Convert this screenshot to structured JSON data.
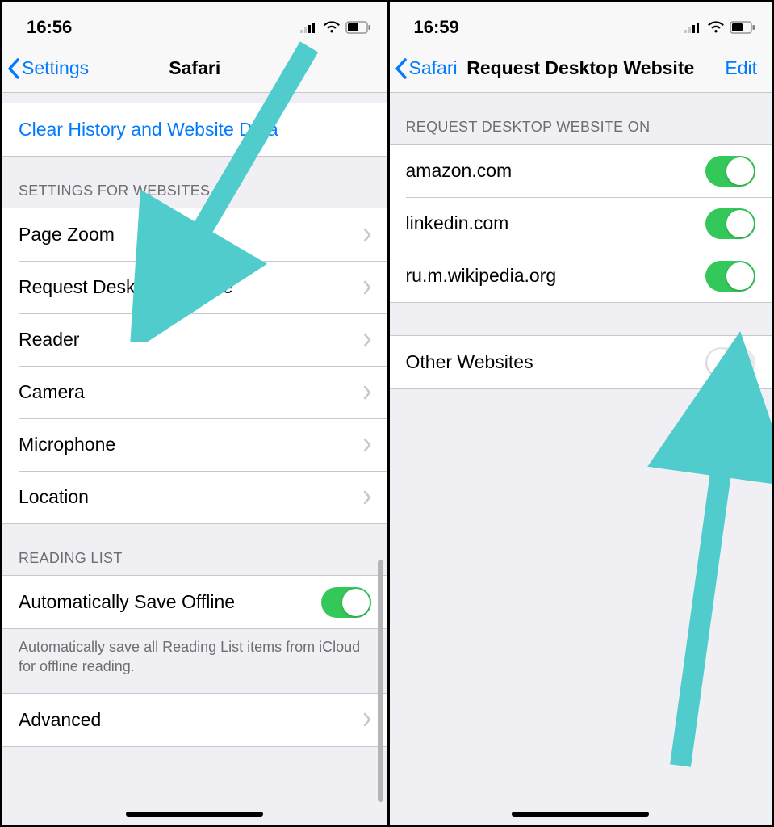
{
  "left": {
    "status_time": "16:56",
    "nav_back": "Settings",
    "nav_title": "Safari",
    "clear_label": "Clear History and Website Data",
    "section_websites": "SETTINGS FOR WEBSITES",
    "rows": {
      "page_zoom": "Page Zoom",
      "request_desktop": "Request Desktop Website",
      "reader": "Reader",
      "camera": "Camera",
      "microphone": "Microphone",
      "location": "Location"
    },
    "section_reading": "READING LIST",
    "auto_save": "Automatically Save Offline",
    "auto_save_footer": "Automatically save all Reading List items from iCloud for offline reading.",
    "advanced": "Advanced"
  },
  "right": {
    "status_time": "16:59",
    "nav_back": "Safari",
    "nav_title": "Request Desktop Website",
    "nav_edit": "Edit",
    "section_on": "REQUEST DESKTOP WEBSITE ON",
    "sites": [
      {
        "domain": "amazon.com",
        "on": true
      },
      {
        "domain": "linkedin.com",
        "on": true
      },
      {
        "domain": "ru.m.wikipedia.org",
        "on": true
      }
    ],
    "other": "Other Websites",
    "other_on": false
  }
}
